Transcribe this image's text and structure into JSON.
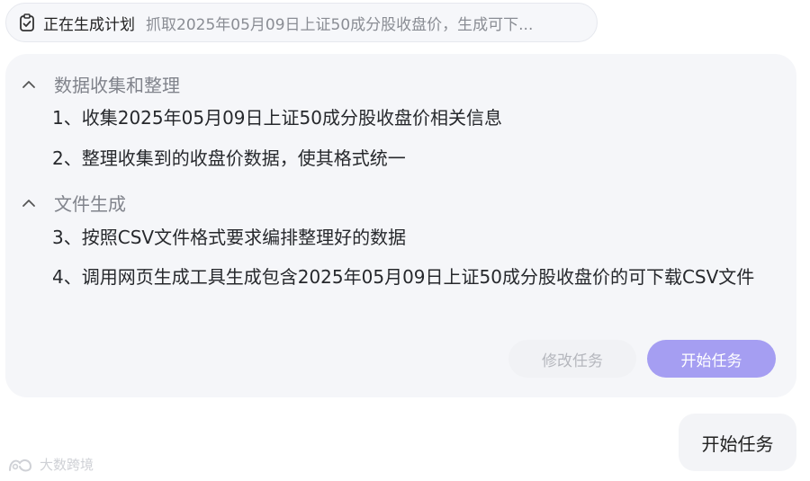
{
  "status_pill": {
    "icon": "clipboard-check-icon",
    "label": "正在生成计划",
    "detail": "抓取2025年05月09日上证50成分股收盘价，生成可下..."
  },
  "plan": {
    "sections": [
      {
        "title": "数据收集和整理",
        "icon": "chevron-up-icon",
        "steps": [
          "1、收集2025年05月09日上证50成分股收盘价相关信息",
          "2、整理收集到的收盘价数据，使其格式统一"
        ]
      },
      {
        "title": "文件生成",
        "icon": "chevron-up-icon",
        "steps": [
          "3、按照CSV文件格式要求编排整理好的数据",
          "4、调用网页生成工具生成包含2025年05月09日上证50成分股收盘价的可下载CSV文件"
        ]
      }
    ],
    "buttons": {
      "modify": "修改任务",
      "start": "开始任务"
    }
  },
  "user_message": "开始任务",
  "watermark": "大数跨境",
  "colors": {
    "accent": "#a59ef2",
    "card_bg": "#f5f6f9",
    "muted_text": "#80838b"
  }
}
